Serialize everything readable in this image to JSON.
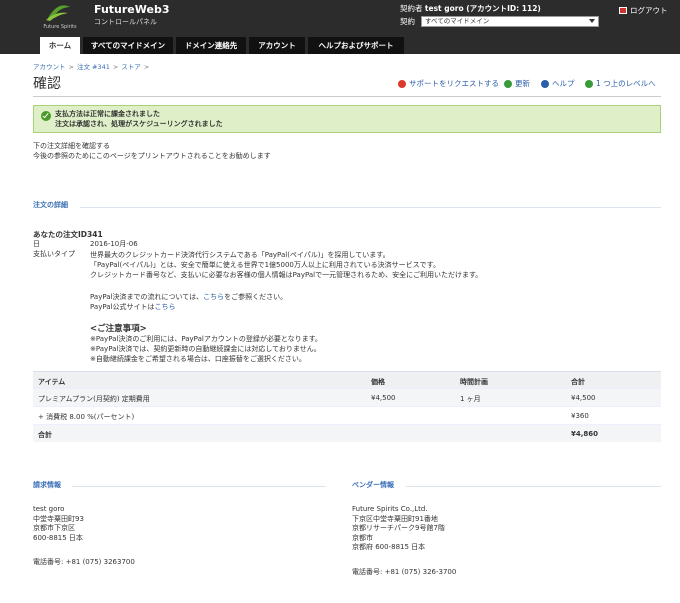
{
  "header": {
    "logo_text": "Future Spirits",
    "brand_name": "FutureWeb3",
    "brand_sub": "コントロールパネル",
    "account_prefix": "契約者",
    "account_user": "test goro (アカウントID: 112)",
    "contract_label": "契約",
    "contract_value": "すべてのマイドメイン",
    "logout_label": "ログアウト"
  },
  "nav": {
    "tabs": [
      {
        "label": "ホーム"
      },
      {
        "label": "すべてのマイドメイン"
      },
      {
        "label": "ドメイン連絡先"
      },
      {
        "label": "アカウント"
      },
      {
        "label": "ヘルプおよびサポート"
      }
    ]
  },
  "breadcrumb": [
    "アカウント",
    "注文 #341",
    "ストア"
  ],
  "page": {
    "title": "確認",
    "actions": {
      "support": "サポートをリクエストする",
      "refresh": "更新",
      "help": "ヘルプ",
      "up": "1 つ上のレベルへ"
    }
  },
  "alert": {
    "line1": "支払方法は正常に課金されました",
    "line2": "注文は承認され、処理がスケジューリングされました"
  },
  "intro": {
    "line1": "下の注文詳細を確認する",
    "line2": "今後の参照のためにこのページをプリントアウトされることをお勧めします"
  },
  "order": {
    "section_title": "注文の詳細",
    "title": "あなたの注文ID341",
    "date_label": "日",
    "date_value": "2016-10月-06",
    "paytype_label": "支払いタイプ",
    "pay_lines": [
      "世界最大のクレジットカード決済代行システムである「PayPal(ペイパル)」を採用しています。",
      "「PayPal(ペイパル)」とは、安全で簡単に使える世界で1億5000万人以上に利用されている決済サービスです。",
      "クレジットカード番号など、支払いに必要なお客様の個人情報はPayPalで一元管理されるため、安全にご利用いただけます。"
    ],
    "flow_prefix": "PayPal決済までの流れについては、",
    "flow_link": "こちら",
    "flow_suffix": "をご参照ください。",
    "site_prefix": "PayPal公式サイトは",
    "site_link": "こちら",
    "notice_title": "<ご注意事項>",
    "notice_lines": [
      "※PayPal決済のご利用には、PayPalアカウントの登録が必要となります。",
      "※PayPal決済では、契約更新時の自動継続課金には対応しておりません。",
      "※自動継続課金をご希望される場合は、口座振替をご選択ください。"
    ]
  },
  "table": {
    "headers": {
      "item": "アイテム",
      "price": "価格",
      "period": "時間計画",
      "total": "合計"
    },
    "rows": [
      {
        "item": "プレミアムプラン(月契約) 定期費用",
        "price": "¥4,500",
        "period": "1 ヶ月",
        "total": "¥4,500"
      },
      {
        "item": "+ 消費税 8.00 %(パーセント)",
        "price": "",
        "period": "",
        "total": "¥360"
      }
    ],
    "sum_label": "合計",
    "sum_value": "¥4,860"
  },
  "billing": {
    "title": "請求情報",
    "lines": [
      "test goro",
      "中堂寺粟田町93",
      "京都市下京区",
      "600-8815 日本"
    ],
    "phone": "電話番号: +81 (075) 3263700"
  },
  "vendor": {
    "title": "ベンダー情報",
    "lines": [
      "Future Spirits Co.,Ltd.",
      "下京区中堂寺粟田町91番地",
      "京都リサーチパーク9号館7階",
      "京都市",
      "京都府 600-8815 日本"
    ],
    "phone": "電話番号: +81 (075) 326-3700"
  }
}
